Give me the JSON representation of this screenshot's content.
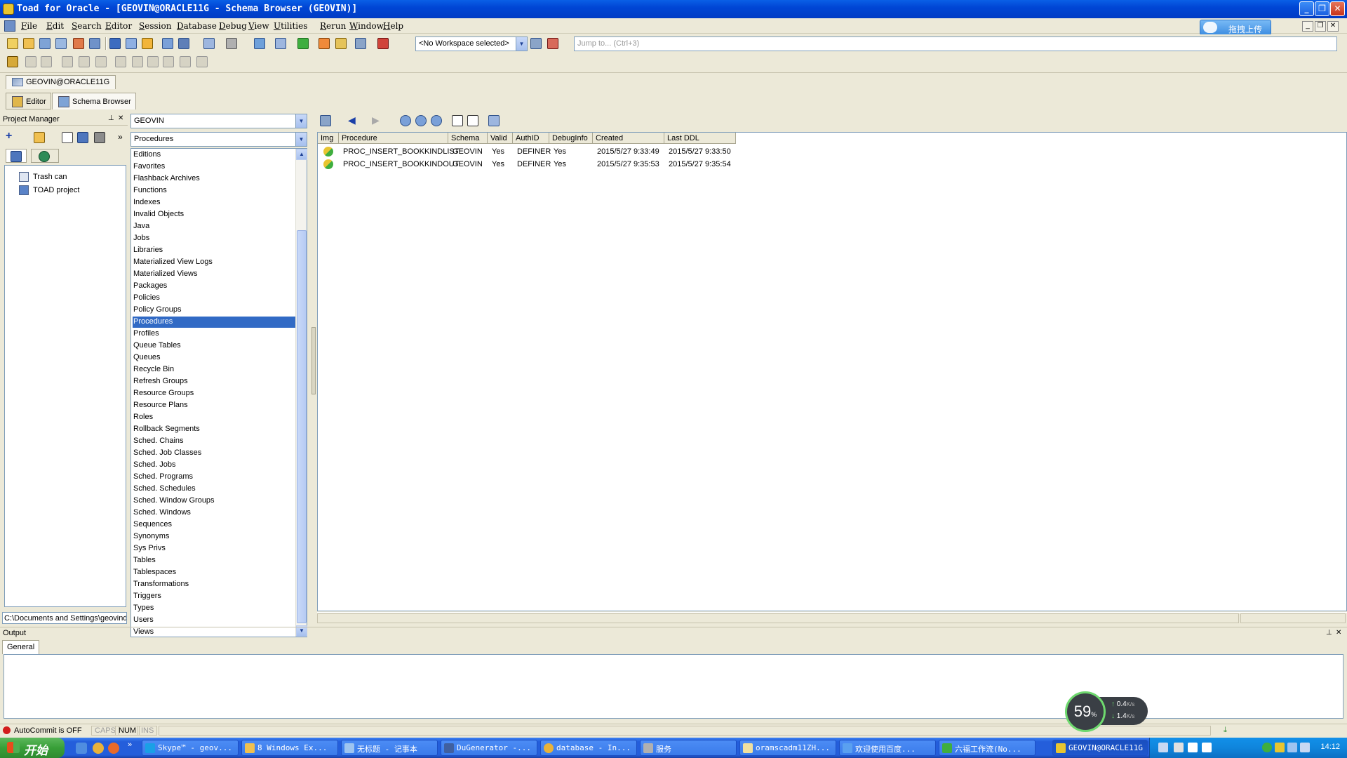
{
  "window": {
    "title": "Toad for Oracle - [GEOVIN@ORACLE11G - Schema Browser (GEOVIN)]"
  },
  "menu": [
    "File",
    "Edit",
    "Search",
    "Editor",
    "Session",
    "Database",
    "Debug",
    "View",
    "Utilities",
    "Rerun",
    "Window",
    "Help"
  ],
  "cloud_button": "拖拽上传",
  "workspace": {
    "selected": "<No Workspace selected>",
    "jump_placeholder": "Jump to... (Ctrl+3)"
  },
  "connection_tab": "GEOVIN@ORACLE11G",
  "doc_tabs": [
    "Editor",
    "Schema Browser"
  ],
  "project_manager": {
    "title": "Project Manager",
    "items": [
      "Trash can",
      "TOAD project"
    ],
    "path": "C:\\Documents and Settings\\geovind"
  },
  "schema_browser": {
    "schema": "GEOVIN",
    "object_type": "Procedures",
    "object_types": [
      "Editions",
      "Favorites",
      "Flashback Archives",
      "Functions",
      "Indexes",
      "Invalid Objects",
      "Java",
      "Jobs",
      "Libraries",
      "Materialized View Logs",
      "Materialized Views",
      "Packages",
      "Policies",
      "Policy Groups",
      "Procedures",
      "Profiles",
      "Queue Tables",
      "Queues",
      "Recycle Bin",
      "Refresh Groups",
      "Resource Groups",
      "Resource Plans",
      "Roles",
      "Rollback Segments",
      "Sched. Chains",
      "Sched. Job Classes",
      "Sched. Jobs",
      "Sched. Programs",
      "Sched. Schedules",
      "Sched. Window Groups",
      "Sched. Windows",
      "Sequences",
      "Synonyms",
      "Sys Privs",
      "Tables",
      "Tablespaces",
      "Transformations",
      "Triggers",
      "Types",
      "Users",
      "Views"
    ],
    "selected_index": 14
  },
  "grid": {
    "columns": [
      "Img",
      "Procedure",
      "Schema",
      "Valid",
      "AuthID",
      "DebugInfo",
      "Created",
      "Last DDL"
    ],
    "rows": [
      [
        "",
        "PROC_INSERT_BOOKKINDLIST",
        "GEOVIN",
        "Yes",
        "DEFINER",
        "Yes",
        "2015/5/27 9:33:49",
        "2015/5/27 9:33:50"
      ],
      [
        "",
        "PROC_INSERT_BOOKKINDOUT",
        "GEOVIN",
        "Yes",
        "DEFINER",
        "Yes",
        "2015/5/27 9:35:53",
        "2015/5/27 9:35:54"
      ]
    ]
  },
  "output": {
    "title": "Output",
    "tab": "General"
  },
  "status": {
    "autocommit": "AutoCommit is OFF",
    "caps": "CAPS",
    "num": "NUM",
    "ins": "INS"
  },
  "net_widget": {
    "percent": "59",
    "percent_unit": "%",
    "up": "0.4",
    "down": "1.4",
    "unit": "K/s"
  },
  "taskbar": {
    "start": "开始",
    "tasks": [
      "Skype™ - geov...",
      "8 Windows Ex...",
      "无标题 - 记事本",
      "DuGenerator -...",
      "database - In...",
      "服务",
      "oramscadm11ZH...",
      "欢迎使用百度...",
      "六福工作流(No...",
      "GEOVIN@ORACLE11G"
    ],
    "clock": "14:12"
  },
  "colors": {
    "selection": "#316ac5",
    "title_bar": "#0046d5",
    "taskbar": "#245edb"
  }
}
